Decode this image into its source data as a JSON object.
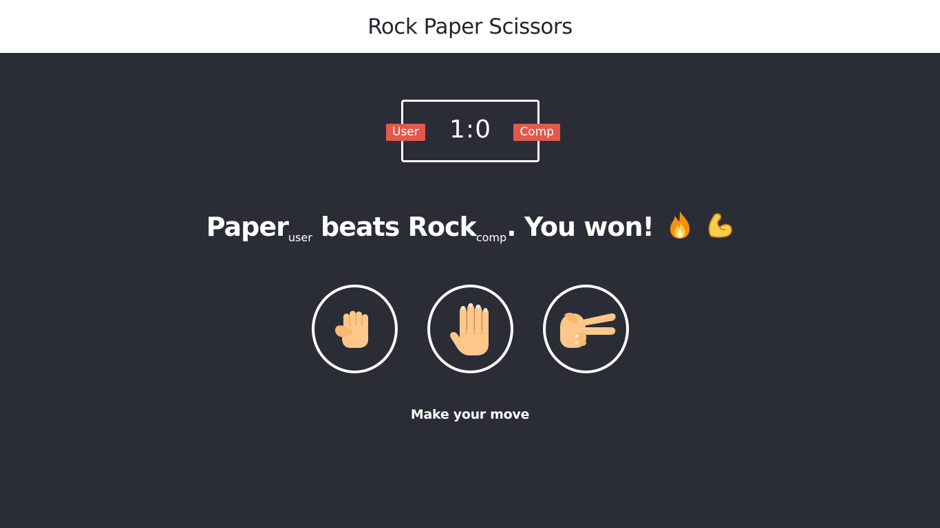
{
  "header": {
    "title": "Rock Paper Scissors"
  },
  "scoreboard": {
    "user_label": "User",
    "comp_label": "Comp",
    "score": "1:0",
    "user_score": 1,
    "comp_score": 0
  },
  "result": {
    "user_choice": "Paper",
    "user_sub": "user",
    "verb": "beats",
    "comp_choice": "Rock",
    "comp_sub": "comp",
    "outcome": ". You won!",
    "emojis": [
      "fire-icon",
      "flexed-biceps-icon"
    ]
  },
  "choices": [
    {
      "name": "rock",
      "icon": "fist-hand-icon"
    },
    {
      "name": "paper",
      "icon": "open-hand-icon"
    },
    {
      "name": "scissors",
      "icon": "victory-hand-sideways-icon"
    }
  ],
  "message": "Make your move",
  "colors": {
    "background": "#2b2d36",
    "header_bg": "#ffffff",
    "badge": "#e2584d",
    "skin": "#fcc78a",
    "skin_shadow": "#f2a960",
    "text": "#ffffff"
  }
}
